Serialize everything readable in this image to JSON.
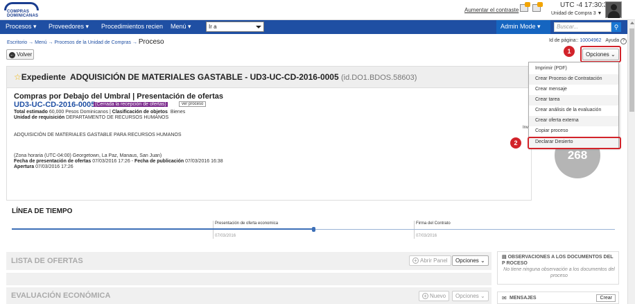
{
  "header": {
    "logo_text": "COMPRAS DOMINICANAS",
    "contrast_link": "Aumentar el contraste",
    "timezone_time": "UTC -4 17:30:34",
    "unit": "Unidad de Compra 3"
  },
  "nav": {
    "items": [
      "Procesos",
      "Proveedores",
      "Procedimientos recien",
      "Menú"
    ],
    "goto": "Ir a",
    "admin_mode": "Admin Mode",
    "search_placeholder": "Buscar..."
  },
  "breadcrumb": {
    "items": [
      "Escritorio",
      "Menú",
      "Procesos de la Unidad de Compras"
    ],
    "current": "Proceso"
  },
  "page_id": {
    "label": "Id de página::",
    "value": "10004962",
    "help": "Ayuda"
  },
  "buttons": {
    "back": "Volver",
    "options": "Opciones"
  },
  "expediente": {
    "label": "Expediente",
    "title": "ADQUISICIÓN DE MATERIALES GASTABLE - UD3-UC-CD-2016-0005",
    "id_ref": "(id.DO1.BDOS.58603)"
  },
  "process": {
    "title": "Compras por Debajo del Umbral | Presentación de ofertas",
    "code": "UD3-UC-CD-2016-0005",
    "status": "(Cerrada la recepción de ofertas)",
    "view_button": "ver proceso",
    "total_label": "Total estimado",
    "total_value": "60,000 Pesos Dominicanos",
    "class_label": "Clasificación de objetos",
    "class_value": "Bienes",
    "unit_label": "Unidad de requisición",
    "unit_value": "DEPARTAMENTO DE RECURSOS HUMANOS",
    "description": "ADQUISICIÓN DE MATERIALES GASTABLE PARA RECURSOS HUMANOS",
    "timezone": "(Zona horaria (UTC-04:00) Georgetown, La Paz, Manaus, San Juan)",
    "submission_label": "Fecha de presentación de ofertas",
    "submission_value": "07/03/2016 17:26",
    "publication_label": "Fecha de publicación",
    "publication_value": "07/03/2016 16:38",
    "opening_label": "Apertura",
    "opening_value": "07/03/2016 17:26"
  },
  "counter": {
    "label": "Inv",
    "value": "268"
  },
  "dropdown": {
    "items": [
      "Imprimir (PDF)",
      "Crear Proceso de Contratación",
      "Crear mensaje",
      "Crear tarea",
      "Crear análisis de la evaluación",
      "Crear oferta externa",
      "Copiar proceso",
      "Declarar Desierto"
    ]
  },
  "annotations": {
    "step1": "1",
    "step2": "2"
  },
  "timeline": {
    "title": "LÍNEA DE TIEMPO",
    "events": [
      {
        "label": "Presentación de oferta economica",
        "date": "07/03/2016"
      },
      {
        "label": "Firma del Contrato",
        "date": "07/03/2016"
      }
    ]
  },
  "sections": {
    "offers": {
      "title": "LISTA DE OFERTAS",
      "open_panel": "Abrir Panel",
      "options": "Opciones"
    },
    "evaluation": {
      "title": "EVALUACIÓN ECONÓMICA",
      "new": "Nuevo",
      "options": "Opciones"
    }
  },
  "side": {
    "observations_title": "OBSERVACIONES A LOS DOCUMENTOS DEL P ROCESO",
    "observations_empty": "No tiene ninguna observación a los documentos del proceso",
    "messages_title": "MENSAJES",
    "create": "Crear"
  },
  "colors": {
    "nav": "#1f4fa3",
    "status": "#7b2a8c",
    "highlight": "#d2232a",
    "admin": "#1565c0"
  }
}
